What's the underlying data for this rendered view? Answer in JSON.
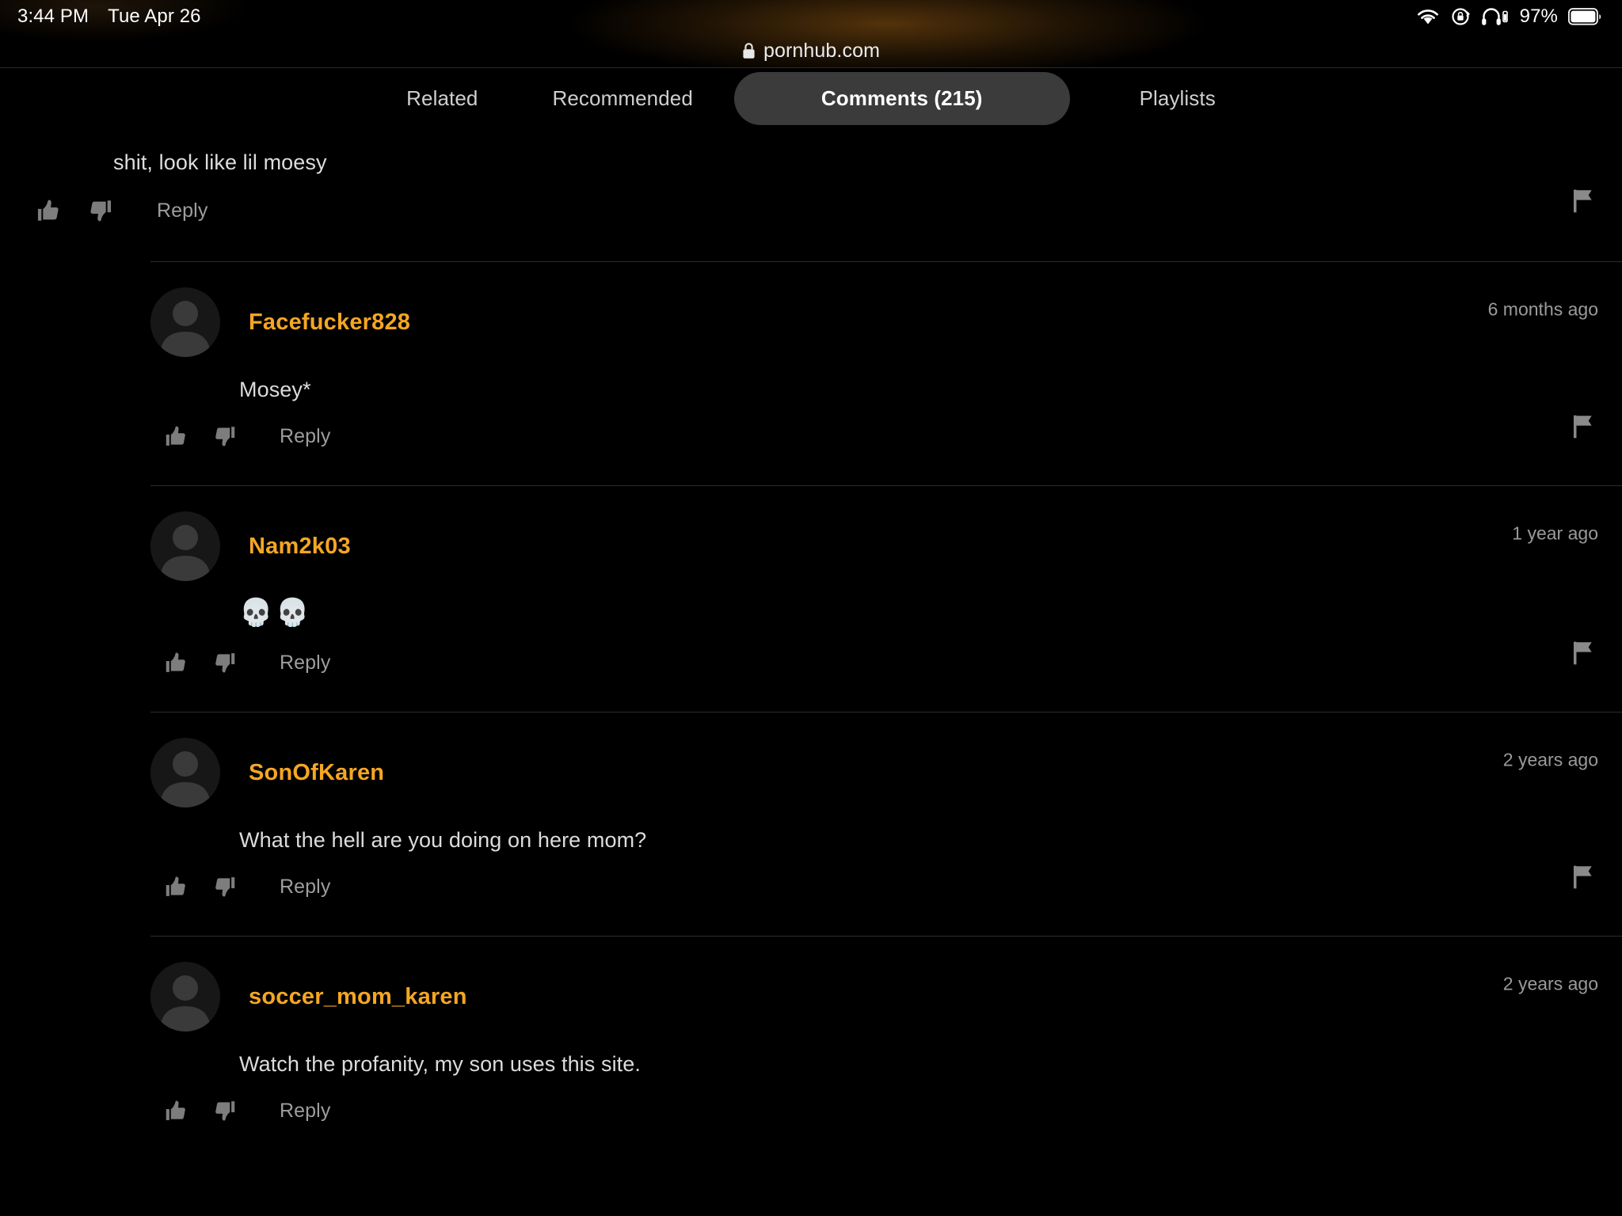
{
  "status_bar": {
    "time": "3:44 PM",
    "date": "Tue Apr 26",
    "battery_percent": "97%",
    "icons": [
      "wifi-icon",
      "rotation-lock-icon",
      "headphones-icon",
      "battery-icon"
    ]
  },
  "browser": {
    "url": "pornhub.com",
    "lock_icon": "lock-icon"
  },
  "tabs": [
    {
      "label": "Related",
      "active": false
    },
    {
      "label": "Recommended",
      "active": false
    },
    {
      "label": "Comments (215)",
      "active": true
    },
    {
      "label": "Playlists",
      "active": false
    }
  ],
  "colors": {
    "username": "#f5a623",
    "active_tab_bg": "#3b3b3b",
    "body_text": "#dcdcdc",
    "muted": "#9a9a9a",
    "divider": "#2c2c2c"
  },
  "action_labels": {
    "reply": "Reply",
    "thumbs_up": "thumbs-up-icon",
    "thumbs_down": "thumbs-down-icon",
    "flag": "flag-icon"
  },
  "comments": [
    {
      "username": "",
      "timestamp": "",
      "text": "shit,  look like lil moesy",
      "reply_label": "Reply",
      "partial": true
    },
    {
      "username": "Facefucker828",
      "timestamp": "6 months ago",
      "text": "Mosey*",
      "reply_label": "Reply",
      "partial": false
    },
    {
      "username": "Nam2k03",
      "timestamp": "1 year ago",
      "text": "💀💀",
      "reply_label": "Reply",
      "partial": false
    },
    {
      "username": "SonOfKaren",
      "timestamp": "2 years ago",
      "text": "What the hell are you doing on here mom?",
      "reply_label": "Reply",
      "partial": false
    },
    {
      "username": "soccer_mom_karen",
      "timestamp": "2 years ago",
      "text": "Watch the profanity, my son uses this site.",
      "reply_label": "Reply",
      "partial": false
    }
  ]
}
